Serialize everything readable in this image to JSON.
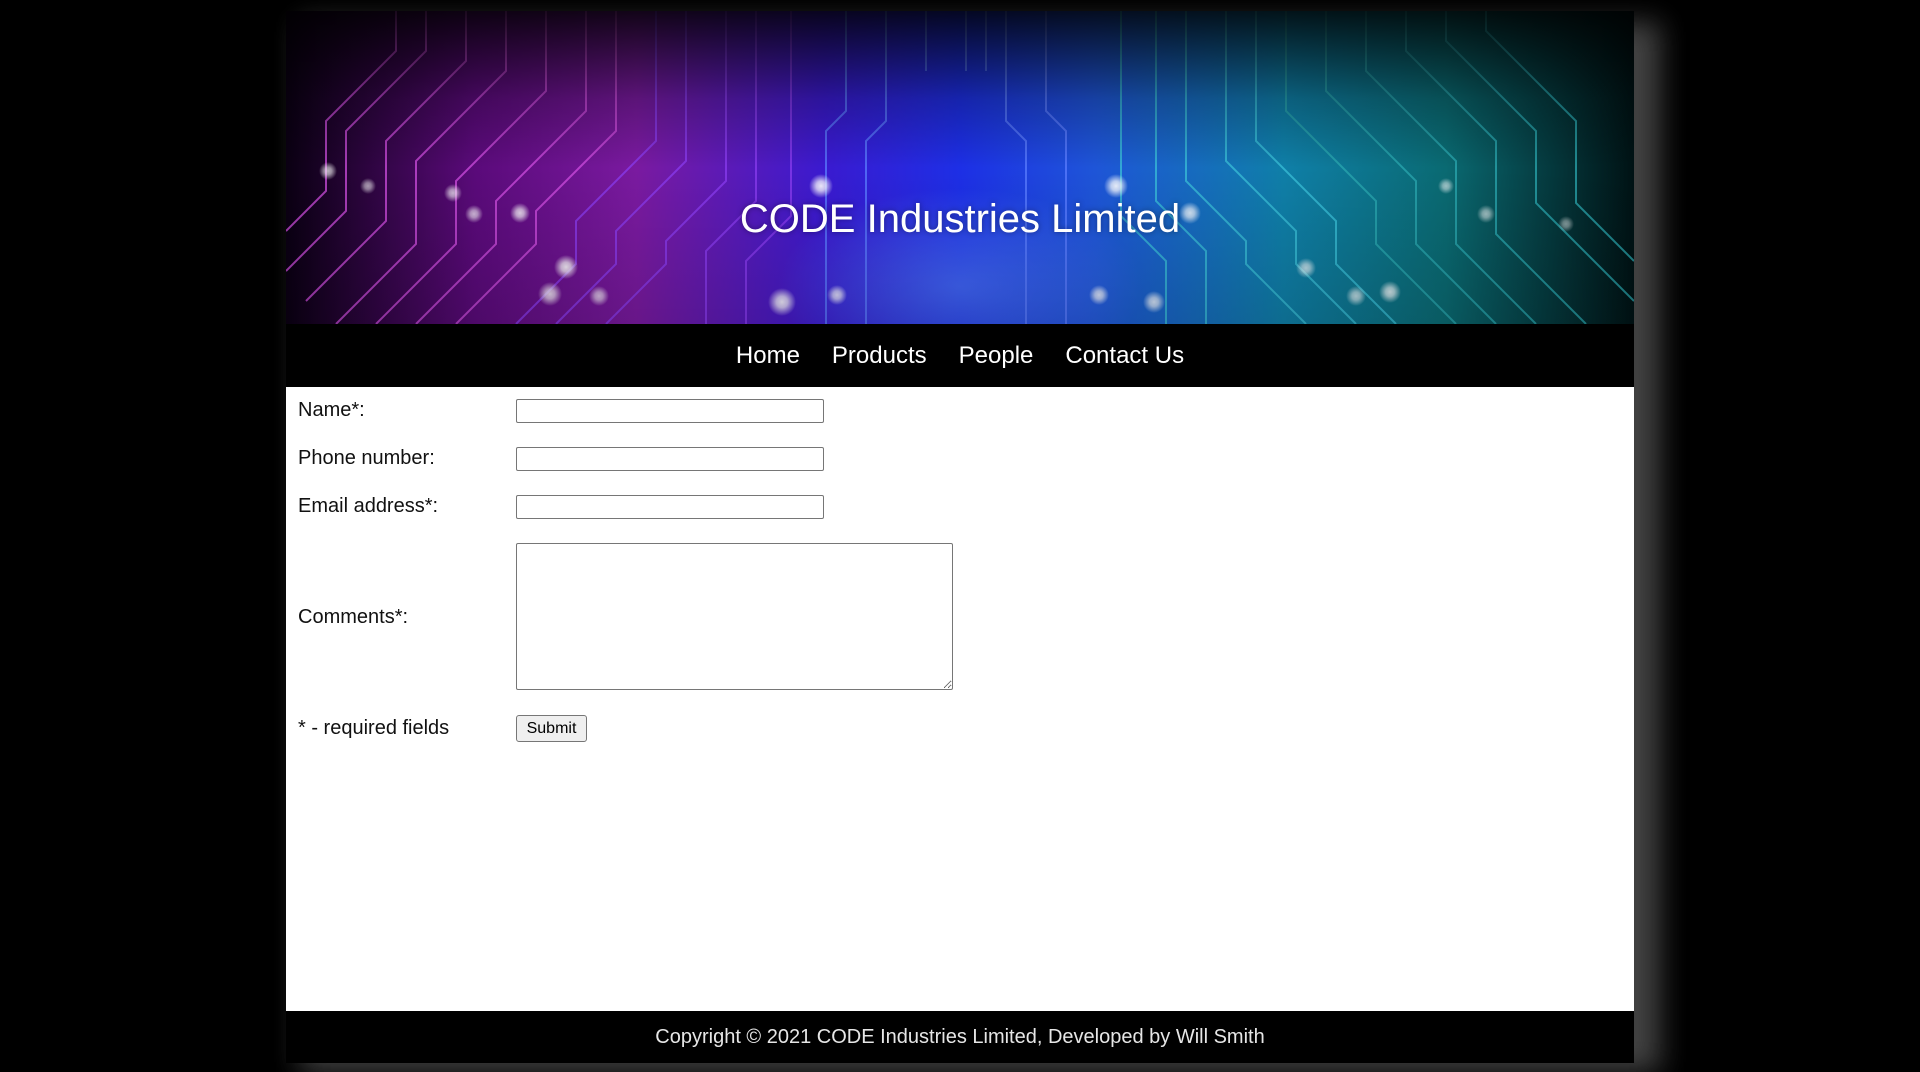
{
  "banner": {
    "title": "CODE Industries Limited"
  },
  "nav": {
    "items": [
      "Home",
      "Products",
      "People",
      "Contact Us"
    ]
  },
  "form": {
    "name_label": "Name*:",
    "name_value": "",
    "phone_label": "Phone number:",
    "phone_value": "",
    "email_label": "Email address*:",
    "email_value": "",
    "comments_label": "Comments*:",
    "comments_value": "",
    "required_note": "* - required fields",
    "submit_label": "Submit"
  },
  "footer": {
    "text": "Copyright © 2021 CODE Industries Limited, Developed by Will Smith"
  },
  "colors": {
    "background": "#000000",
    "page": "#ffffff",
    "banner_magenta": "#7a1aa0",
    "banner_blue": "#1d2fe6",
    "banner_teal": "#0f7fa8"
  }
}
